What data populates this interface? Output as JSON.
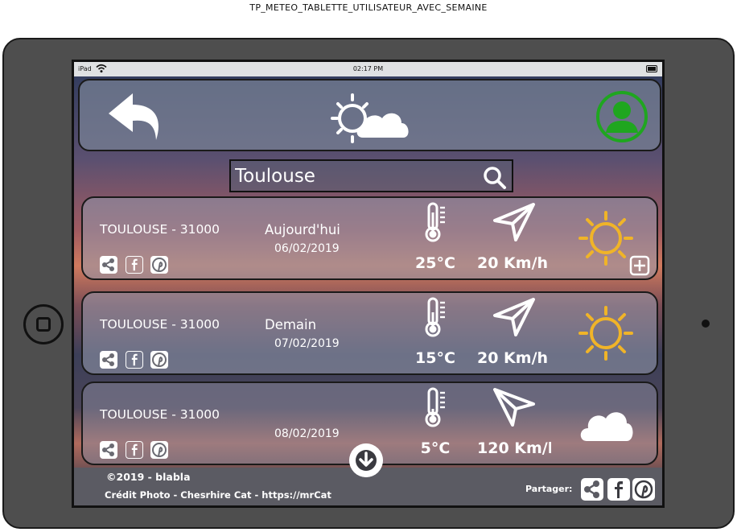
{
  "page_title": "TP_METEO_TABLETTE_UTILISATEUR_AVEC_SEMAINE",
  "status_bar": {
    "device": "iPad",
    "time": "02:17 PM"
  },
  "search": {
    "value": "Toulouse"
  },
  "days": [
    {
      "city": "TOULOUSE - 31000",
      "label": "Aujourd'hui",
      "date": "06/02/2019",
      "temp": "25°C",
      "wind": "20 Km/h",
      "condition": "sun-icon"
    },
    {
      "city": "TOULOUSE - 31000",
      "label": "Demain",
      "date": "07/02/2019",
      "temp": "15°C",
      "wind": "20 Km/h",
      "condition": "sun-icon"
    },
    {
      "city": "TOULOUSE - 31000",
      "label": "",
      "date": "08/02/2019",
      "temp": "5°C",
      "wind": "120 Km/h",
      "condition": "cloud-icon"
    }
  ],
  "footer": {
    "copyright": "©2019 - blabla",
    "credit": "Crédit Photo - Chesrhire Cat - https://mrCat",
    "share_label": "Partager:"
  },
  "colors": {
    "profile": "#1fa61f",
    "sun": "#f0b428",
    "status_bar": "#dfe1e3",
    "footer": "#5b5b63"
  }
}
